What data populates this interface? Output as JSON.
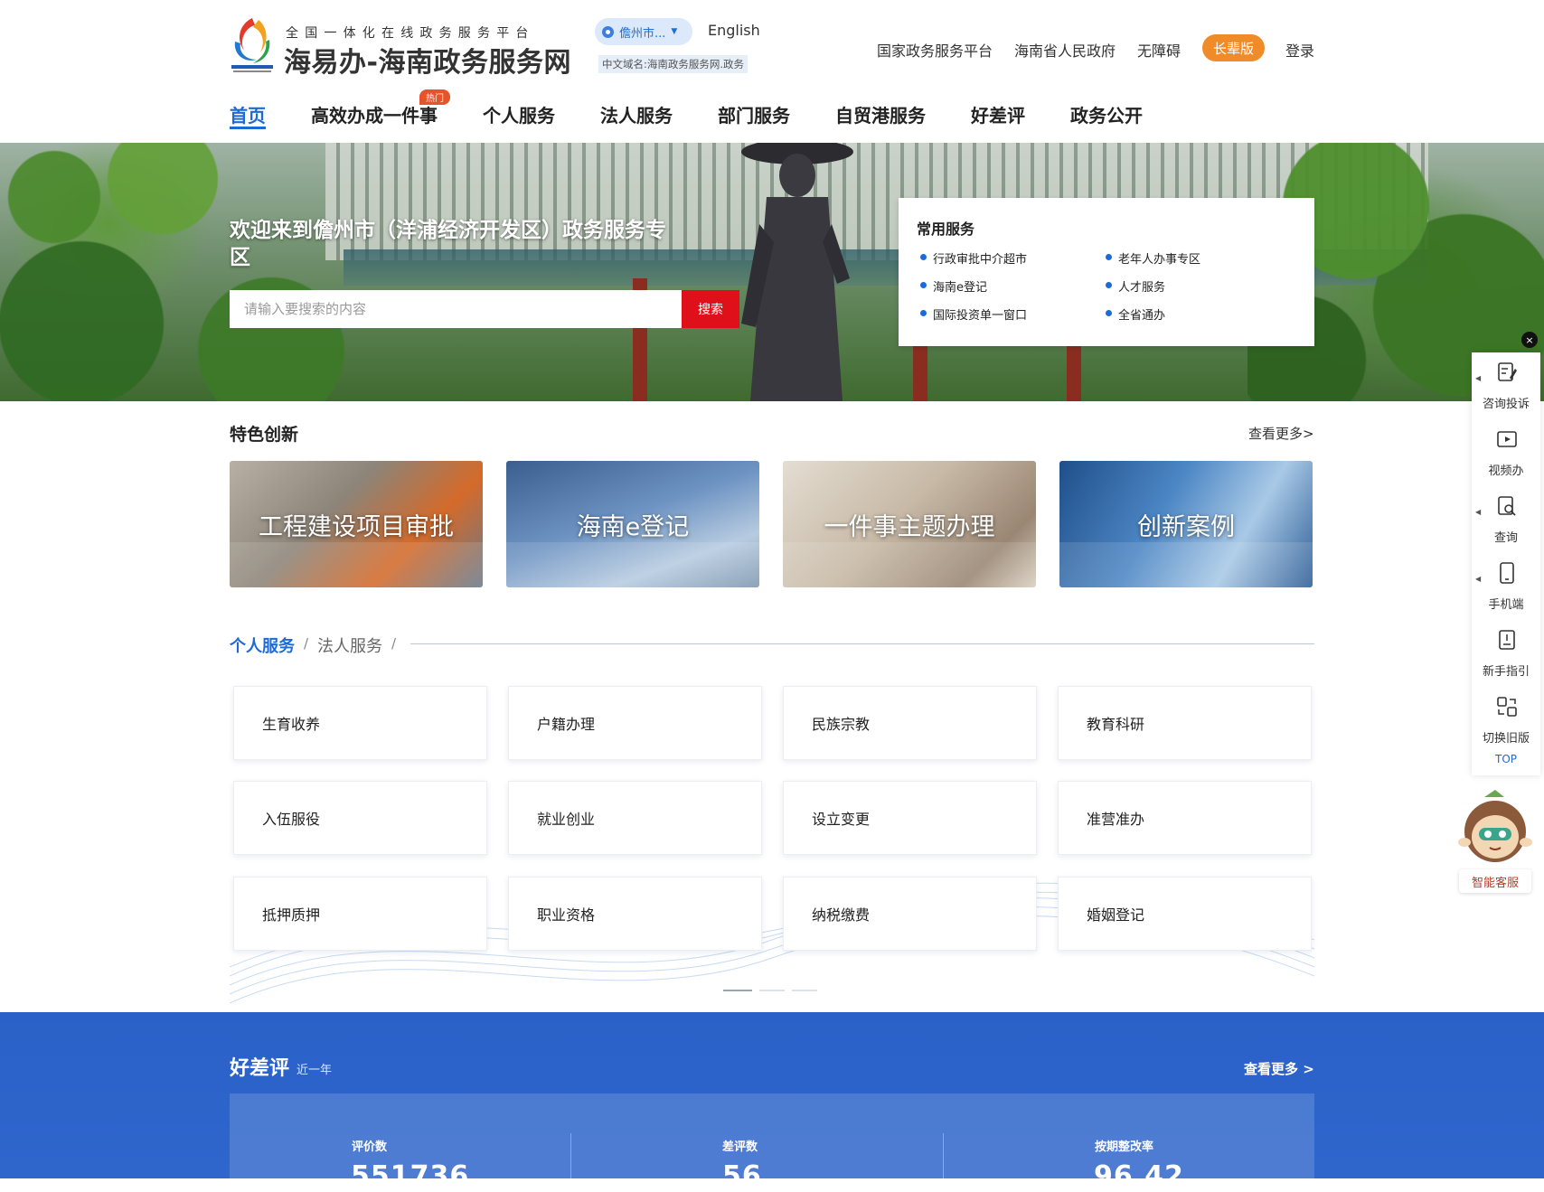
{
  "header": {
    "slogan": "全国一体化在线政务服务平台",
    "brand": "海易办-海南政务服务网",
    "city": "儋州市...",
    "english": "English",
    "domain_note": "中文域名:海南政务服务网.政务",
    "links": [
      "国家政务服务平台",
      "海南省人民政府",
      "无障碍"
    ],
    "elder": "长辈版",
    "login": "登录"
  },
  "nav": {
    "items": [
      "首页",
      "高效办成一件事",
      "个人服务",
      "法人服务",
      "部门服务",
      "自贸港服务",
      "好差评",
      "政务公开"
    ],
    "hot_tag": "热门"
  },
  "banner": {
    "welcome": "欢迎来到儋州市（洋浦经济开发区）政务服务专区",
    "search_placeholder": "请输入要搜索的内容",
    "search_button": "搜索",
    "common_title": "常用服务",
    "common_items": [
      "行政审批中介超市",
      "老年人办事专区",
      "海南e登记",
      "人才服务",
      "国际投资单一窗口",
      "全省通办"
    ]
  },
  "features": {
    "title": "特色创新",
    "more": "查看更多>",
    "cards": [
      "工程建设项目审批",
      "海南e登记",
      "一件事主题办理",
      "创新案例"
    ]
  },
  "services": {
    "tab_personal": "个人服务",
    "tab_legal": "法人服务",
    "separator": "/",
    "items": [
      "生育收养",
      "户籍办理",
      "民族宗教",
      "教育科研",
      "入伍服役",
      "就业创业",
      "设立变更",
      "准营准办",
      "抵押质押",
      "职业资格",
      "纳税缴费",
      "婚姻登记"
    ]
  },
  "evaluation": {
    "title": "好差评",
    "subtitle": "近一年",
    "more": "查看更多 >",
    "stats": [
      {
        "label": "评价数",
        "value": "551736"
      },
      {
        "label": "差评数",
        "value": "56"
      },
      {
        "label": "按期整改率",
        "value": "96.42"
      }
    ]
  },
  "toolbar": {
    "items": [
      "咨询投诉",
      "视频办",
      "查询",
      "手机端",
      "新手指引",
      "切换旧版"
    ],
    "top": "TOP",
    "close": "×",
    "assistant": "智能客服"
  },
  "colors": {
    "primary": "#1d6ad7",
    "search_red": "#e0101b",
    "elder_orange": "#f08b2a",
    "footer_blue": "#2a61c8"
  }
}
